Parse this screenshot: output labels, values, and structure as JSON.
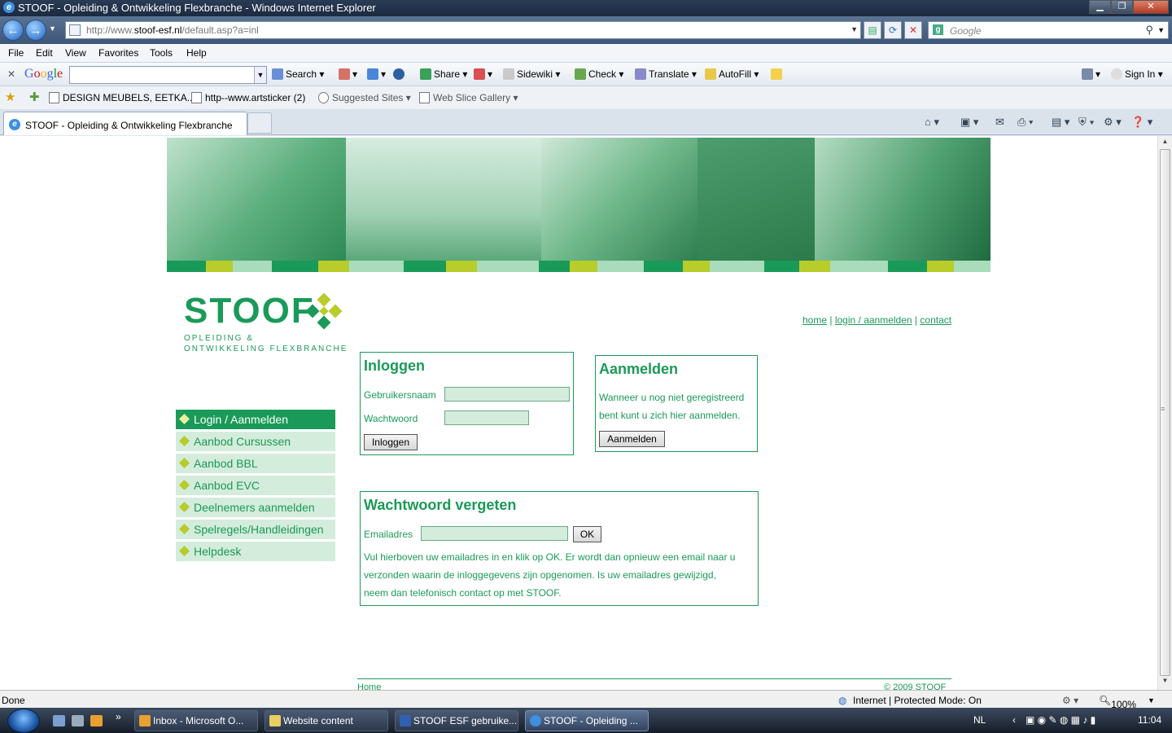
{
  "window": {
    "title": "STOOF - Opleiding & Ontwikkeling Flexbranche - Windows Internet Explorer"
  },
  "address": {
    "url_prefix": "http://www.",
    "url_domain": "stoof-esf.nl",
    "url_path": "/default.asp?a=inl"
  },
  "search": {
    "placeholder": "Google"
  },
  "menu": {
    "file": "File",
    "edit": "Edit",
    "view": "View",
    "favorites": "Favorites",
    "tools": "Tools",
    "help": "Help"
  },
  "google_toolbar": {
    "logo_letters": [
      "G",
      "o",
      "o",
      "g",
      "l",
      "e"
    ],
    "search": "Search",
    "share": "Share",
    "sidewiki": "Sidewiki",
    "check": "Check",
    "translate": "Translate",
    "autofill": "AutoFill",
    "sign_in": "Sign In"
  },
  "favorites": {
    "item1": "DESIGN MEUBELS, EETKA...",
    "item2": "http--www.artsticker (2)",
    "suggested": "Suggested Sites",
    "webslice": "Web Slice Gallery"
  },
  "tab": {
    "title": "STOOF - Opleiding & Ontwikkeling Flexbranche"
  },
  "site": {
    "logo_word": "STOOF",
    "logo_tag_line1": "OPLEIDING &",
    "logo_tag_line2": "ONTWIKKELING FLEXBRANCHE",
    "toplinks": {
      "home": "home",
      "sep1": "|",
      "login": "login / aanmelden",
      "sep2": "|",
      "contact": "contact"
    },
    "nav": [
      "Login / Aanmelden",
      "Aanbod Cursussen",
      "Aanbod BBL",
      "Aanbod EVC",
      "Deelnemers aanmelden",
      "Spelregels/Handleidingen",
      "Helpdesk"
    ],
    "login": {
      "title": "Inloggen",
      "user_label": "Gebruikersnaam",
      "pass_label": "Wachtwoord",
      "button": "Inloggen"
    },
    "register": {
      "title": "Aanmelden",
      "text_line1": "Wanneer u nog niet geregistreerd",
      "text_line2": "bent kunt u zich hier aanmelden.",
      "button": "Aanmelden"
    },
    "forgot": {
      "title": "Wachtwoord vergeten",
      "email_label": "Emailadres",
      "button": "OK",
      "text_line1": "Vul hierboven uw emailadres in en klik op OK. Er wordt dan opnieuw een email naar u",
      "text_line2": "verzonden waarin de inloggegevens zijn opgenomen. Is uw emailadres gewijzigd,",
      "text_line3": "neem dan telefonisch contact op met STOOF."
    },
    "footer_left": "Home",
    "footer_right": "© 2009 STOOF"
  },
  "status": {
    "left": "Done",
    "zone": "Internet | Protected Mode: On",
    "zoom": "100%"
  },
  "taskbar": {
    "items": [
      "Inbox - Microsoft O...",
      "Website content",
      "STOOF ESF gebruike...",
      "STOOF - Opleiding ..."
    ],
    "lang": "NL",
    "time": "11:04"
  },
  "colors": {
    "brand_green": "#1a9a58",
    "light_green": "#d4ecdc",
    "lime": "#b8cc2a"
  }
}
